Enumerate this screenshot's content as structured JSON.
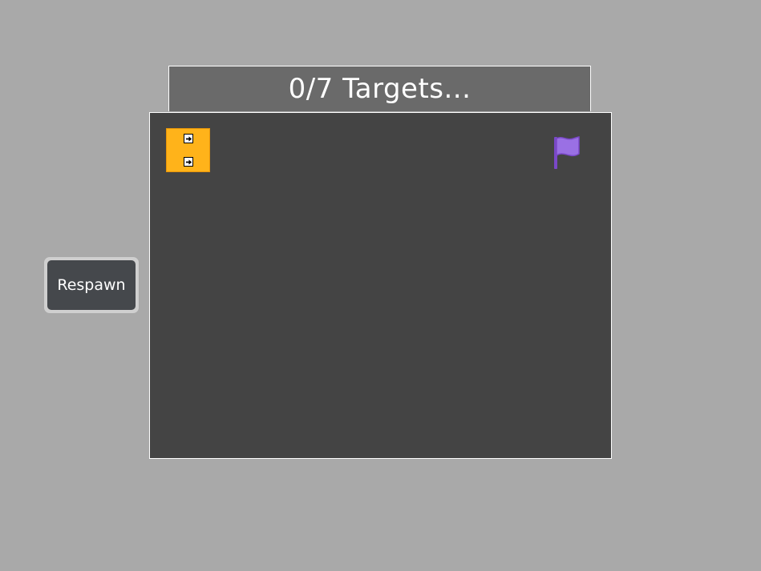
{
  "header": {
    "targets_text": "0/7 Targets..."
  },
  "controls": {
    "respawn_label": "Respawn"
  },
  "board": {
    "player_commands": [
      "right-arrow-icon",
      "right-arrow-icon"
    ],
    "goal_icon": "flag-icon"
  },
  "colors": {
    "background": "#a9a9a9",
    "board": "#444444",
    "title_bar": "#6a6a6a",
    "player": "#ffb31a",
    "flag": "#8a5cd6",
    "button": "#45484c"
  }
}
